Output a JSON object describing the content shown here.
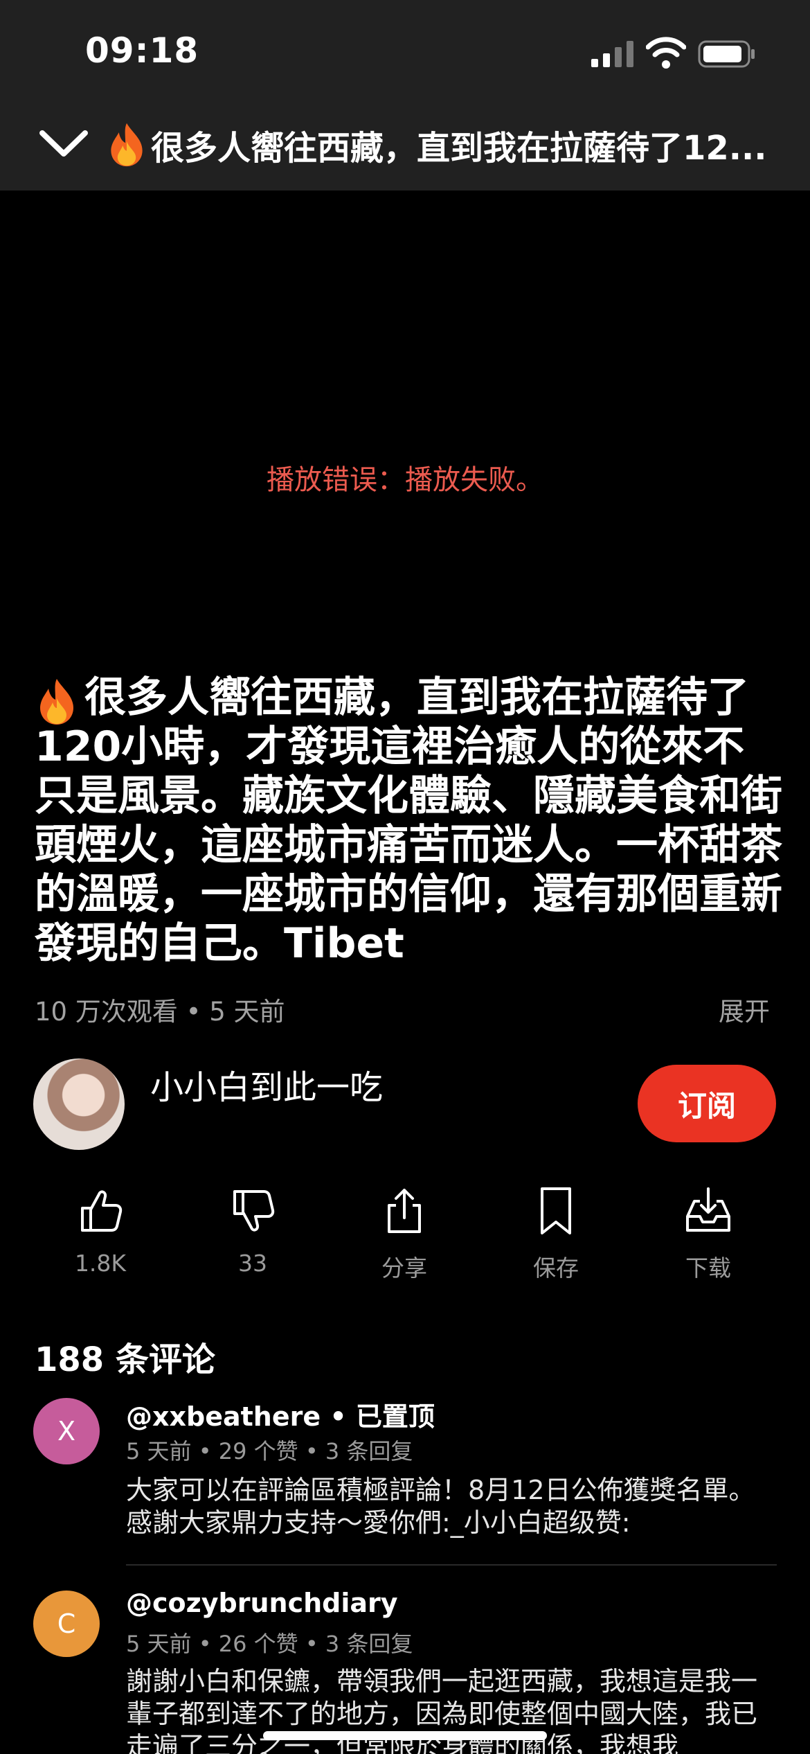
{
  "status_bar": {
    "time": "09:18"
  },
  "header": {
    "title": "很多人嚮往西藏，直到我在拉薩待了12..."
  },
  "video": {
    "error_text": "播放错误：播放失败。"
  },
  "description": {
    "text": "很多人嚮往西藏，直到我在拉薩待了120小時，才發現這裡治癒人的從來不只是風景。藏族文化體驗、隱藏美食和街頭煙火，這座城市痛苦而迷人。一杯甜茶的溫暖，一座城市的信仰，還有那個重新發現的自己。Tibet",
    "meta": "10 万次观看 • 5 天前",
    "expand_label": "展开"
  },
  "channel": {
    "name": "小小白到此一吃",
    "subscribe_label": "订阅"
  },
  "actions": [
    {
      "icon": "thumbs-up-icon",
      "label": "1.8K"
    },
    {
      "icon": "thumbs-down-icon",
      "label": "33"
    },
    {
      "icon": "share-icon",
      "label": "分享"
    },
    {
      "icon": "bookmark-icon",
      "label": "保存"
    },
    {
      "icon": "download-icon",
      "label": "下载"
    }
  ],
  "comments": {
    "count_label": "188 条评论",
    "items": [
      {
        "avatar_letter": "X",
        "avatar_color": "#c65c9b",
        "user": "@xxbeathere • 已置顶",
        "meta": "5 天前 • 29 个赞 • 3 条回复",
        "text": "大家可以在評論區積極評論！8月12日公佈獲獎名單。感謝大家鼎力支持～愛你們:_小小白超级赞:"
      },
      {
        "avatar_letter": "C",
        "avatar_color": "#e8973a",
        "user": "@cozybrunchdiary",
        "meta": "5 天前 • 26 个赞 • 3 条回复",
        "text": "謝謝小白和保鑣，帶領我們一起逛西藏，我想這是我一輩子都到達不了的地方，因為即使整個中國大陸，我已走遍了三分之一，但常限於身體的關係，我想我"
      }
    ]
  }
}
